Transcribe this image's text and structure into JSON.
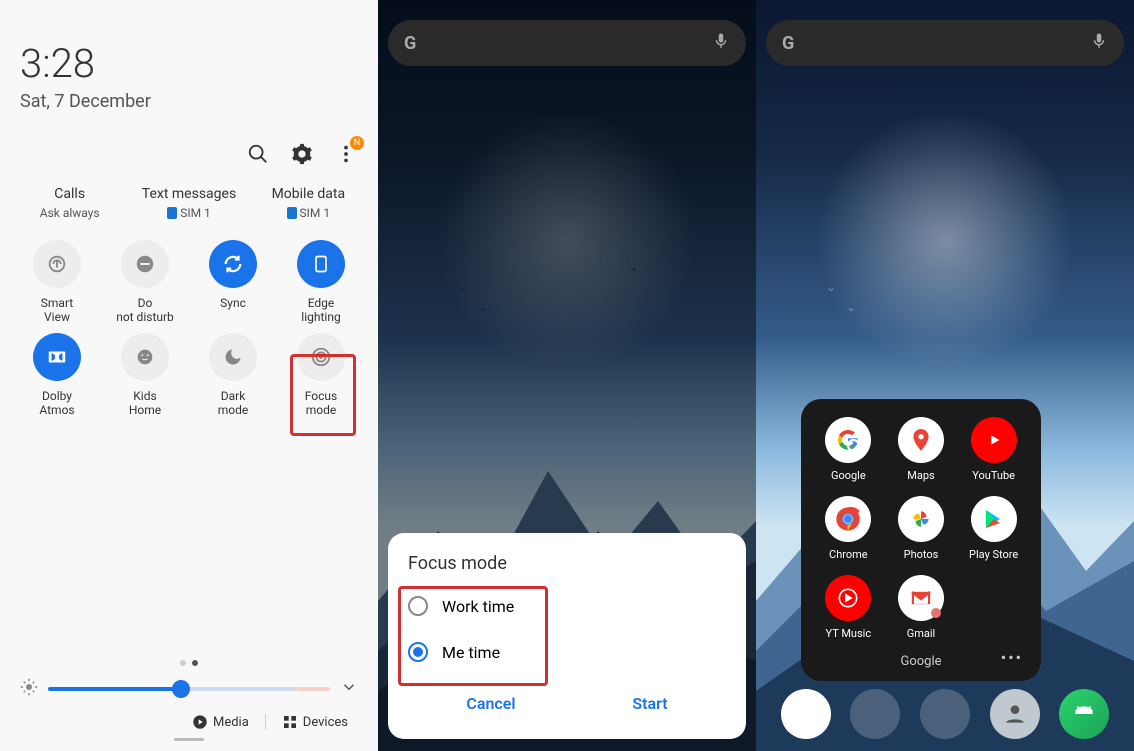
{
  "screen1": {
    "time": "3:28",
    "date": "Sat, 7 December",
    "badge": "N",
    "sims": [
      {
        "title": "Calls",
        "sub": "Ask always",
        "chip": false
      },
      {
        "title": "Text messages",
        "sub": "SIM 1",
        "chip": true
      },
      {
        "title": "Mobile data",
        "sub": "SIM 1",
        "chip": true
      }
    ],
    "toggles": [
      {
        "label": "Smart View",
        "on": false,
        "icon": "cast"
      },
      {
        "label": "Do not disturb",
        "on": false,
        "icon": "dnd"
      },
      {
        "label": "Sync",
        "on": true,
        "icon": "sync"
      },
      {
        "label": "Edge lighting",
        "on": true,
        "icon": "edge"
      },
      {
        "label": "Dolby Atmos",
        "on": true,
        "icon": "dolby"
      },
      {
        "label": "Kids Home",
        "on": false,
        "icon": "kids"
      },
      {
        "label": "Dark mode",
        "on": false,
        "icon": "dark"
      },
      {
        "label": "Focus mode",
        "on": false,
        "icon": "focus"
      }
    ],
    "media": "Media",
    "devices": "Devices"
  },
  "screen2": {
    "dialog_title": "Focus mode",
    "options": [
      {
        "label": "Work time",
        "selected": false
      },
      {
        "label": "Me time",
        "selected": true
      }
    ],
    "cancel": "Cancel",
    "start": "Start"
  },
  "screen3": {
    "apps": [
      {
        "label": "Google",
        "icon": "google"
      },
      {
        "label": "Maps",
        "icon": "maps"
      },
      {
        "label": "YouTube",
        "icon": "youtube"
      },
      {
        "label": "Chrome",
        "icon": "chrome"
      },
      {
        "label": "Photos",
        "icon": "photos"
      },
      {
        "label": "Play Store",
        "icon": "play"
      },
      {
        "label": "YT Music",
        "icon": "ytmusic"
      },
      {
        "label": "Gmail",
        "icon": "gmail"
      }
    ],
    "folder_name": "Google"
  }
}
